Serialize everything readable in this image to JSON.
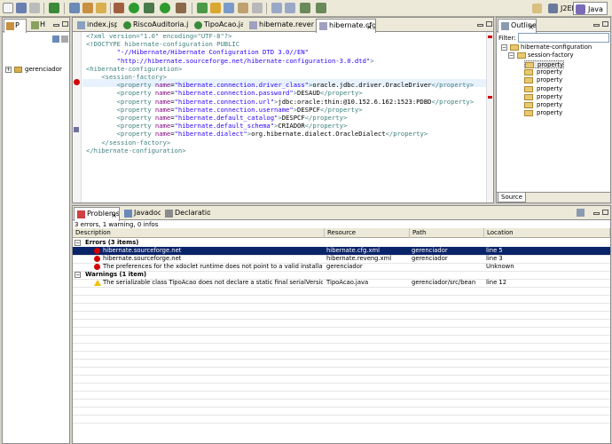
{
  "toolbar": {
    "perspective_j2ee": "J2EE",
    "perspective_java": "Java"
  },
  "left_panel": {
    "tabs": [
      "P",
      "H"
    ],
    "tree": [
      {
        "label": "gerenciador"
      }
    ]
  },
  "editor": {
    "tabs": [
      {
        "label": "index.jsp"
      },
      {
        "label": "RiscoAuditoria.java"
      },
      {
        "label": "TipoAcao.java"
      },
      {
        "label": "hibernate.reveng.xml"
      },
      {
        "label": "hibernate.cfg.xml",
        "selected": true
      }
    ],
    "code_lines": [
      "<?xml version=\"1.0\" encoding=\"UTF-8\"?>",
      "<!DOCTYPE hibernate-configuration PUBLIC",
      "        \"-//Hibernate/Hibernate Configuration DTD 3.0//EN\"",
      "        \"http://hibernate.sourceforge.net/hibernate-configuration-3.0.dtd\">",
      "<hibernate-configuration>",
      "    <session-factory>",
      "        <property name=\"hibernate.connection.driver_class\">oracle.jdbc.driver.OracleDriver</property>",
      "        <property name=\"hibernate.connection.password\">DESAUD</property>",
      "        <property name=\"hibernate.connection.url\">jdbc:oracle:thin:@10.152.6.162:1523:PDBD</property>",
      "        <property name=\"hibernate.connection.username\">DESPCF</property>",
      "        <property name=\"hibernate.default_catalog\">DESPCF</property>",
      "        <property name=\"hibernate.default_schema\">CRIADOR</property>",
      "        <property name=\"hibernate.dialect\">org.hibernate.dialect.OracleDialect</property>",
      "    </session-factory>",
      "</hibernate-configuration>"
    ]
  },
  "outline": {
    "title": "Outline",
    "filter_label": "Filter:",
    "root": "hibernate-configuration",
    "child": "session-factory",
    "properties": [
      "property",
      "property",
      "property",
      "property",
      "property",
      "property",
      "property"
    ],
    "bottom_tab": "Source"
  },
  "bottom_panel": {
    "tabs": [
      {
        "label": "Problems",
        "selected": true
      },
      {
        "label": "Javadoc"
      },
      {
        "label": "Declaration"
      }
    ],
    "summary": "3 errors, 1 warning, 0 infos",
    "columns": [
      "Description",
      "Resource",
      "Path",
      "Location"
    ],
    "groups": [
      {
        "label": "Errors (3 items)",
        "items": [
          {
            "description": "hibernate.sourceforge.net",
            "resource": "hibernate.cfg.xml",
            "path": "gerenciador",
            "location": "line 5",
            "selected": true
          },
          {
            "description": "hibernate.sourceforge.net",
            "resource": "hibernate.reveng.xml",
            "path": "gerenciador",
            "location": "line 3"
          },
          {
            "description": "The preferences for the xdoclet runtime does not point to a valid installation.",
            "resource": "gerenciador",
            "path": "",
            "location": "Unknown"
          }
        ]
      },
      {
        "label": "Warnings (1 item)",
        "items": [
          {
            "description": "The serializable class TipoAcao does not declare a static final serialVersionUID field of type long",
            "resource": "TipoAcao.java",
            "path": "gerenciador/src/bean",
            "location": "line 12"
          }
        ]
      }
    ]
  },
  "colors": {
    "selection": "#0a246a",
    "error": "#d40000",
    "warning": "#f0c000",
    "tag": "#3f7f7f",
    "attr": "#7f007f",
    "value": "#2a00ff"
  }
}
